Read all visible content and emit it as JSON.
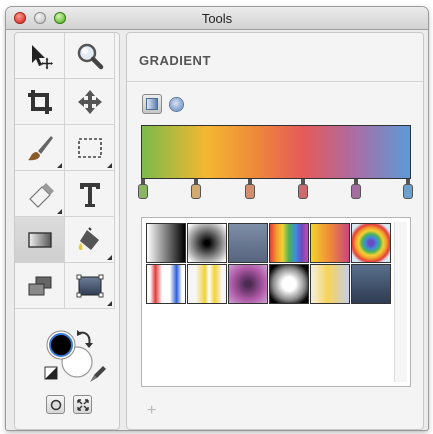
{
  "window": {
    "title": "Tools"
  },
  "tools": [
    {
      "name": "selection-tool",
      "icon": "arrow-move-icon"
    },
    {
      "name": "zoom-tool",
      "icon": "magnifier-icon"
    },
    {
      "name": "crop-tool",
      "icon": "crop-icon"
    },
    {
      "name": "move-tool",
      "icon": "move-arrows-icon"
    },
    {
      "name": "brush-tool",
      "icon": "brush-icon"
    },
    {
      "name": "marquee-tool",
      "icon": "marquee-icon"
    },
    {
      "name": "eraser-tool",
      "icon": "eraser-icon"
    },
    {
      "name": "text-tool",
      "icon": "text-t-icon"
    },
    {
      "name": "gradient-tool",
      "icon": "gradient-icon",
      "selected": true
    },
    {
      "name": "paint-bucket-tool",
      "icon": "paint-bucket-icon"
    },
    {
      "name": "shape-tool",
      "icon": "shapes-icon"
    },
    {
      "name": "transform-tool",
      "icon": "transform-icon"
    }
  ],
  "colors": {
    "foreground": "#000000",
    "background": "#ffffff"
  },
  "gradient_panel": {
    "title": "GRADIENT",
    "types": [
      "linear",
      "radial"
    ],
    "selected_type": "linear",
    "stops": [
      {
        "color": "#8ab565"
      },
      {
        "color": "#d3aa6f"
      },
      {
        "color": "#d48d6d"
      },
      {
        "color": "#cc6a70"
      },
      {
        "color": "#a46ea0"
      },
      {
        "color": "#6c9fcc"
      }
    ],
    "preset_count": 12,
    "add_label": "+"
  }
}
